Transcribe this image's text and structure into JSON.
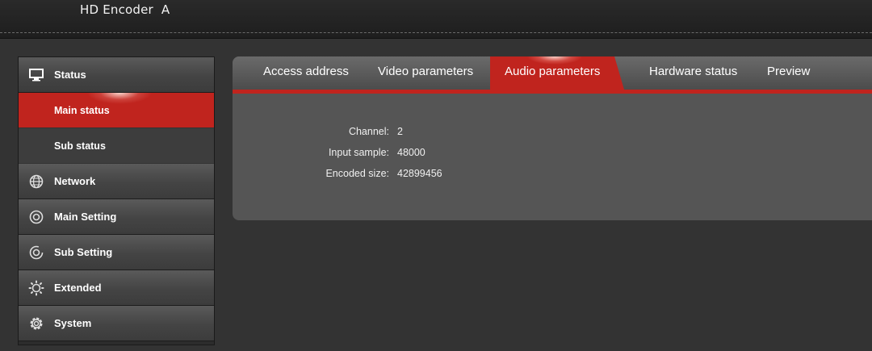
{
  "app": {
    "title": "HD Encoder  A"
  },
  "sidebar": {
    "items": [
      {
        "label": "Status",
        "icon": "monitor-icon"
      },
      {
        "label": "Network",
        "icon": "globe-icon"
      },
      {
        "label": "Main Setting",
        "icon": "target-icon"
      },
      {
        "label": "Sub Setting",
        "icon": "target-icon"
      },
      {
        "label": "Extended",
        "icon": "sun-gear-icon"
      },
      {
        "label": "System",
        "icon": "gear-icon"
      }
    ],
    "status_submenu": [
      {
        "label": "Main status",
        "active": true
      },
      {
        "label": "Sub status",
        "active": false
      }
    ]
  },
  "tabs": [
    {
      "label": "Access address",
      "active": false
    },
    {
      "label": "Video parameters",
      "active": false
    },
    {
      "label": "Audio parameters",
      "active": true
    },
    {
      "label": "Hardware status",
      "active": false
    },
    {
      "label": "Preview",
      "active": false
    }
  ],
  "audio": {
    "channel_label": "Channel:",
    "channel_value": "2",
    "sample_label": "Input sample:",
    "sample_value": "48000",
    "size_label": "Encoded size:",
    "size_value": "42899456"
  },
  "colors": {
    "accent": "#c0241e",
    "background": "#333333",
    "panel": "#555555"
  }
}
